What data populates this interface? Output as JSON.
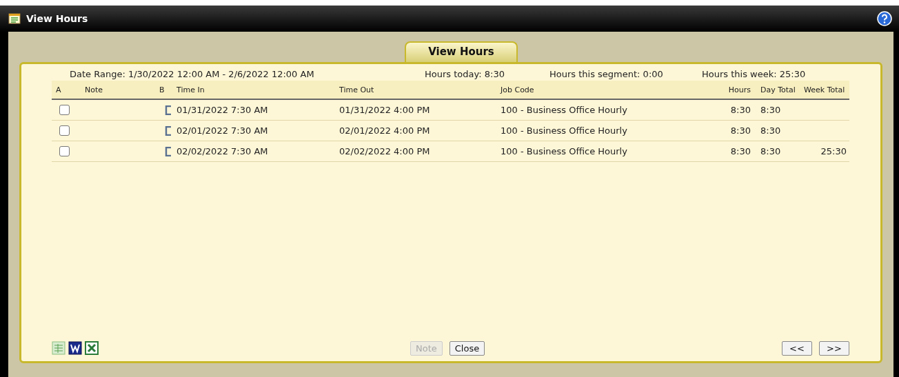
{
  "window": {
    "title": "View Hours"
  },
  "tab": {
    "label": "View Hours",
    "selected": true
  },
  "summary": {
    "date_range": "Date Range: 1/30/2022 12:00 AM - 2/6/2022 12:00 AM",
    "hours_today": "Hours today: 8:30",
    "hours_segment": "Hours this segment: 0:00",
    "hours_week": "Hours this week: 25:30"
  },
  "table": {
    "columns": [
      "A",
      "Note",
      "B",
      "Time In",
      "Time Out",
      "Job Code",
      "Hours",
      "Day Total",
      "Week Total"
    ],
    "rows": [
      {
        "checked": false,
        "note": "",
        "time_in": "01/31/2022 7:30 AM",
        "time_out": "01/31/2022 4:00 PM",
        "job_code": "100 - Business Office Hourly",
        "hours": "8:30",
        "day_total": "8:30",
        "week_total": ""
      },
      {
        "checked": false,
        "note": "",
        "time_in": "02/01/2022 7:30 AM",
        "time_out": "02/01/2022 4:00 PM",
        "job_code": "100 - Business Office Hourly",
        "hours": "8:30",
        "day_total": "8:30",
        "week_total": ""
      },
      {
        "checked": false,
        "note": "",
        "time_in": "02/02/2022 7:30 AM",
        "time_out": "02/02/2022 4:00 PM",
        "job_code": "100 - Business Office Hourly",
        "hours": "8:30",
        "day_total": "8:30",
        "week_total": "25:30"
      }
    ]
  },
  "buttons": [
    {
      "label": "Note",
      "disabled": true
    },
    {
      "label": "Close",
      "disabled": false
    }
  ],
  "pager": [
    {
      "label": "<<"
    },
    {
      "label": ">>"
    }
  ]
}
